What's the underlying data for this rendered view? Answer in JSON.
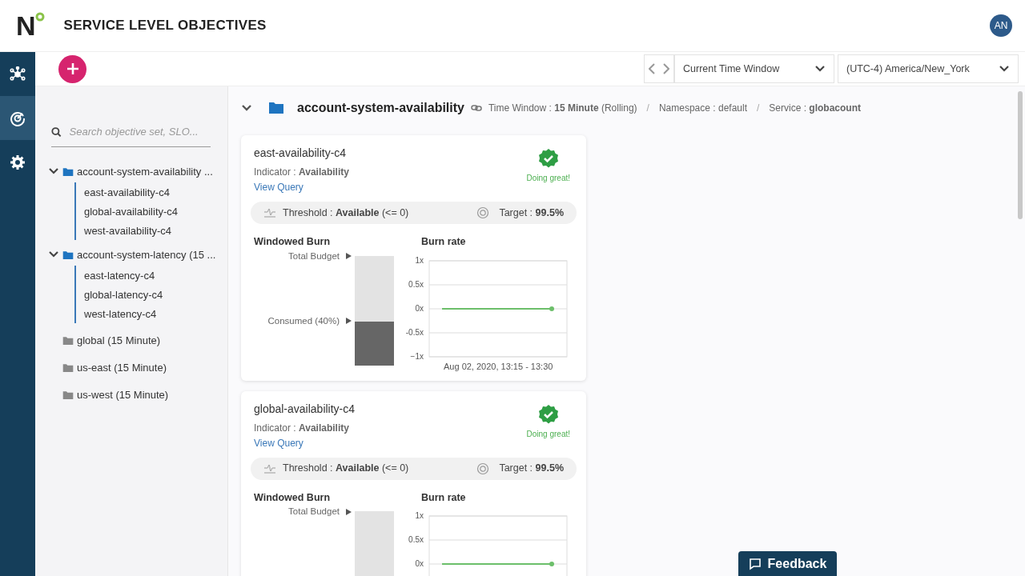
{
  "header": {
    "logo": "N",
    "title": "SERVICE LEVEL OBJECTIVES",
    "avatar": "AN"
  },
  "rail": [
    {
      "selected": false
    },
    {
      "selected": true
    },
    {
      "selected": false
    }
  ],
  "toolbar": {
    "time_window": "Current Time Window",
    "timezone": "(UTC-4) America/New_York"
  },
  "search": {
    "placeholder": "Search objective set, SLO..."
  },
  "tree": [
    {
      "label": "account-system-availability ...",
      "expanded": true,
      "children": [
        {
          "label": "east-availability-c4"
        },
        {
          "label": "global-availability-c4"
        },
        {
          "label": "west-availability-c4"
        }
      ]
    },
    {
      "label": "account-system-latency (15 ...",
      "expanded": true,
      "children": [
        {
          "label": "east-latency-c4"
        },
        {
          "label": "global-latency-c4"
        },
        {
          "label": "west-latency-c4"
        }
      ]
    },
    {
      "label": "global (15 Minute)",
      "expanded": false
    },
    {
      "label": "us-east (15 Minute)",
      "expanded": false
    },
    {
      "label": "us-west (15 Minute)",
      "expanded": false
    }
  ],
  "objective_set": {
    "title": "account-system-availability",
    "expanded": true,
    "meta": [
      {
        "kind": "field",
        "text": "Time Window : **15 Minute** (Rolling)"
      },
      {
        "kind": "separator",
        "text": "/"
      },
      {
        "kind": "field",
        "text": "Namespace : default"
      },
      {
        "kind": "separator",
        "text": "/"
      },
      {
        "kind": "field",
        "text": "Service : **globacount**"
      }
    ]
  },
  "cards": [
    {
      "name": "east-availability-c4",
      "indicator": "Indicator : **Availability**",
      "link": "View Query",
      "status": "Doing great!",
      "threshold": "Threshold : **Available** (<= 0)",
      "target": "Target : **99.5%**",
      "burn_title": "Windowed Burn",
      "total_label": "Total Budget",
      "consumed_label": "Consumed (40%)",
      "level": 0.4,
      "chart_data": {
        "type": "line",
        "xlabel": "Aug 02, 2020, 13:15 - 13:30",
        "grid": true,
        "ylim": [
          -1,
          1
        ],
        "yticks": [
          {
            "value": 1,
            "label": "1x"
          },
          {
            "value": 0.5,
            "label": "0.5x"
          },
          {
            "value": 0,
            "label": "0x"
          },
          {
            "value": -0.5,
            "label": "-0.5x"
          },
          {
            "value": -1,
            "label": "−1x"
          }
        ],
        "series": [
          {
            "name": "Burn rate",
            "color": "#6cbf6a",
            "values": [
              0,
              0,
              0,
              0,
              0,
              0
            ]
          }
        ]
      }
    },
    {
      "name": "global-availability-c4",
      "indicator": "Indicator : **Availability**",
      "link": "View Query",
      "status": "Doing great!",
      "threshold": "Threshold : **Available** (<= 0)",
      "target": "Target : **99.5%**",
      "burn_title": "Windowed Burn",
      "total_label": "Total Budget",
      "chart_data": {
        "type": "line",
        "grid": true,
        "ylim": [
          -1,
          1
        ],
        "yticks": [
          {
            "value": 1,
            "label": "1x"
          },
          {
            "value": 0.5,
            "label": "0.5x"
          },
          {
            "value": 0,
            "label": "0x"
          }
        ],
        "series": [
          {
            "name": "Burn rate",
            "color": "#6cbf6a",
            "values": [
              0,
              0,
              0,
              0,
              0,
              0
            ]
          }
        ]
      }
    }
  ],
  "feedback": "Feedback"
}
